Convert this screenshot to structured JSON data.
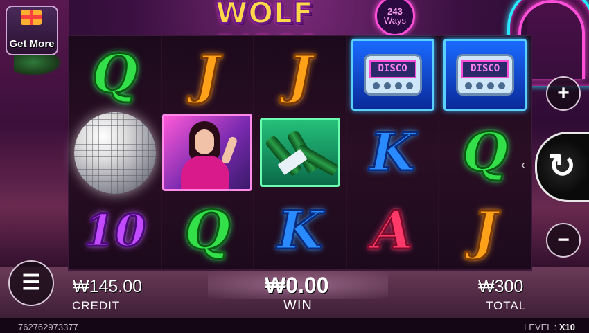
{
  "game": {
    "title": "WOLF DISCO",
    "ways_count": "243",
    "ways_label": "Ways"
  },
  "get_more": {
    "label": "Get More"
  },
  "reels": [
    [
      "Q",
      "disco-ball",
      "10"
    ],
    [
      "J",
      "woman",
      "Q"
    ],
    [
      "J",
      "bottles",
      "K"
    ],
    [
      "disco-pager",
      "K",
      "A"
    ],
    [
      "disco-pager",
      "Q",
      "J"
    ]
  ],
  "pager_text": "DISCO",
  "controls": {
    "plus": "+",
    "minus": "−",
    "spin": "↻",
    "menu": "☰"
  },
  "credit": {
    "amount": "₩145.00",
    "label": "CREDIT"
  },
  "win": {
    "amount": "₩0.00",
    "label": "WIN"
  },
  "total": {
    "amount": "₩300",
    "label": "TOTAL"
  },
  "session_id": "762762973377",
  "level": {
    "label": "LEVEL :",
    "value": "X10"
  },
  "colors": {
    "Q": "#34e04a",
    "J": "#ffa21a",
    "K": "#2a8aff",
    "A": "#ff3a6a",
    "10": "#c24aff",
    "logo": "#ffd84a",
    "neon_pink": "#ff4fd8",
    "neon_cyan": "#29e8ff"
  }
}
